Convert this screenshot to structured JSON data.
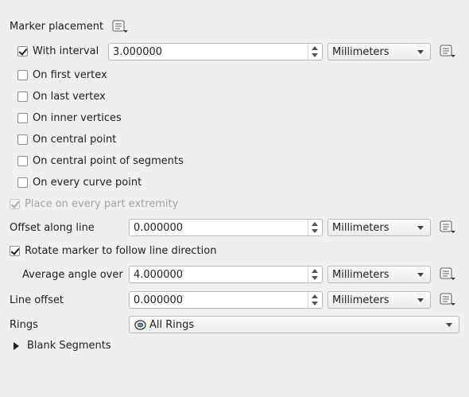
{
  "marker_placement": {
    "title": "Marker placement"
  },
  "interval": {
    "label": "With interval",
    "checked": true,
    "value": "3.000000",
    "unit": "Millimeters"
  },
  "options": [
    {
      "label": "On first vertex",
      "checked": false
    },
    {
      "label": "On last vertex",
      "checked": false
    },
    {
      "label": "On inner vertices",
      "checked": false
    },
    {
      "label": "On central point",
      "checked": false
    },
    {
      "label": "On central point of segments",
      "checked": false
    },
    {
      "label": "On every curve point",
      "checked": false
    }
  ],
  "extremity": {
    "label": "Place on every part extremity",
    "checked": true,
    "enabled": false
  },
  "offset_along_line": {
    "label": "Offset along line",
    "value": "0.000000",
    "unit": "Millimeters"
  },
  "rotate": {
    "label": "Rotate marker to follow line direction",
    "checked": true
  },
  "average_angle": {
    "label": "Average angle over",
    "value": "4.000000",
    "unit": "Millimeters"
  },
  "line_offset": {
    "label": "Line offset",
    "value": "0.000000",
    "unit": "Millimeters"
  },
  "rings": {
    "label": "Rings",
    "value": "All Rings"
  },
  "blank_segments": {
    "label": "Blank Segments"
  },
  "icons": {
    "data_defined": "data-defined-override-icon",
    "rings": "rings-icon",
    "expand": "expand-arrow-icon"
  }
}
